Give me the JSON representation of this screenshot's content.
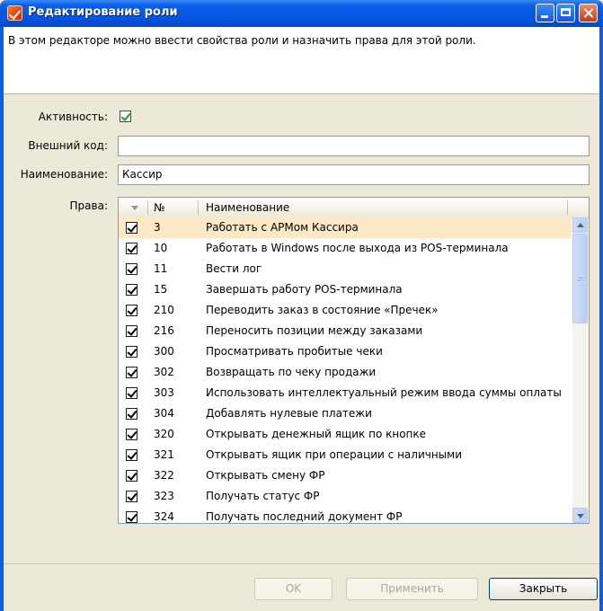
{
  "window": {
    "title": "Редактирование роли"
  },
  "description": "В этом редакторе можно ввести свойства роли и назначить права для этой роли.",
  "form": {
    "active_label": "Активность:",
    "active_checked": true,
    "external_code_label": "Внешний код:",
    "external_code_value": "",
    "name_label": "Наименование:",
    "name_value": "Кассир",
    "rights_label": "Права:"
  },
  "grid": {
    "columns": [
      "№",
      "Наименование"
    ],
    "rows": [
      {
        "checked": true,
        "num": "3",
        "name": "Работать с АРМом Кассира",
        "selected": true
      },
      {
        "checked": true,
        "num": "10",
        "name": "Работать в Windows после выхода из POS-терминала"
      },
      {
        "checked": true,
        "num": "11",
        "name": "Вести лог"
      },
      {
        "checked": true,
        "num": "15",
        "name": "Завершать работу POS-терминала"
      },
      {
        "checked": true,
        "num": "210",
        "name": "Переводить заказ в состояние «Пречек»"
      },
      {
        "checked": true,
        "num": "216",
        "name": "Переносить позиции между заказами"
      },
      {
        "checked": true,
        "num": "300",
        "name": "Просматривать пробитые чеки"
      },
      {
        "checked": true,
        "num": "302",
        "name": "Возвращать по чеку продажи"
      },
      {
        "checked": true,
        "num": "303",
        "name": "Использовать интеллектуальный режим ввода суммы оплаты"
      },
      {
        "checked": true,
        "num": "304",
        "name": "Добавлять нулевые платежи"
      },
      {
        "checked": true,
        "num": "320",
        "name": "Открывать денежный ящик по кнопке"
      },
      {
        "checked": true,
        "num": "321",
        "name": "Открывать ящик при операции с наличными"
      },
      {
        "checked": true,
        "num": "322",
        "name": "Открывать смену ФР"
      },
      {
        "checked": true,
        "num": "323",
        "name": "Получать статус ФР"
      },
      {
        "checked": true,
        "num": "324",
        "name": "Получать последний документ ФР"
      }
    ]
  },
  "buttons": {
    "ok": "OK",
    "apply": "Применить",
    "close": "Закрыть"
  }
}
